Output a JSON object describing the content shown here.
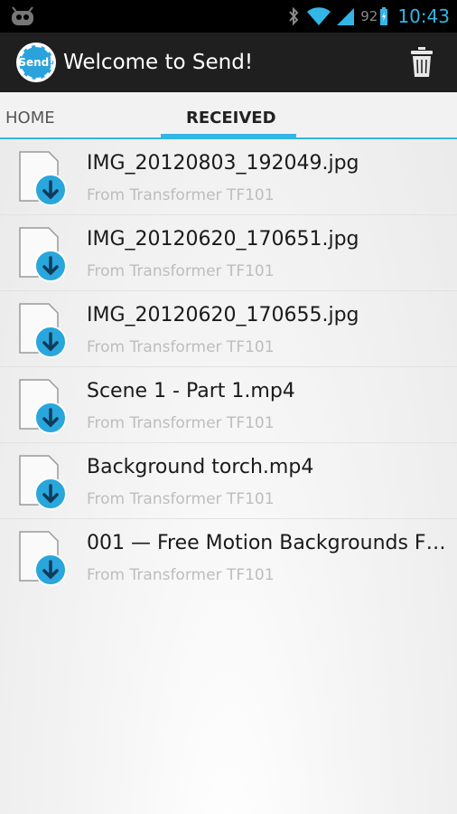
{
  "status_bar": {
    "battery_percent": "92",
    "time": "10:43",
    "icons": [
      "cyanogen-robot-icon",
      "bluetooth-icon",
      "wifi-icon",
      "signal-icon",
      "battery-charging-icon"
    ]
  },
  "action_bar": {
    "logo_text": "Send!",
    "title": "Welcome to Send!",
    "delete_icon": "trash-icon"
  },
  "tabs": [
    {
      "label": "HOME",
      "selected": false
    },
    {
      "label": "RECEIVED",
      "selected": true
    }
  ],
  "files": [
    {
      "name": "IMG_20120803_192049.jpg",
      "source": "From Transformer TF101"
    },
    {
      "name": "IMG_20120620_170651.jpg",
      "source": "From Transformer TF101"
    },
    {
      "name": "IMG_20120620_170655.jpg",
      "source": "From Transformer TF101"
    },
    {
      "name": "Scene 1 - Part 1.mp4",
      "source": "From Transformer TF101"
    },
    {
      "name": "Background torch.mp4",
      "source": "From Transformer TF101"
    },
    {
      "name": "001 — Free Motion Backgrounds  F…",
      "source": "From Transformer TF101"
    }
  ],
  "colors": {
    "accent": "#33b5e5",
    "action_bar": "#1f1f1f",
    "status_bar": "#000000"
  }
}
